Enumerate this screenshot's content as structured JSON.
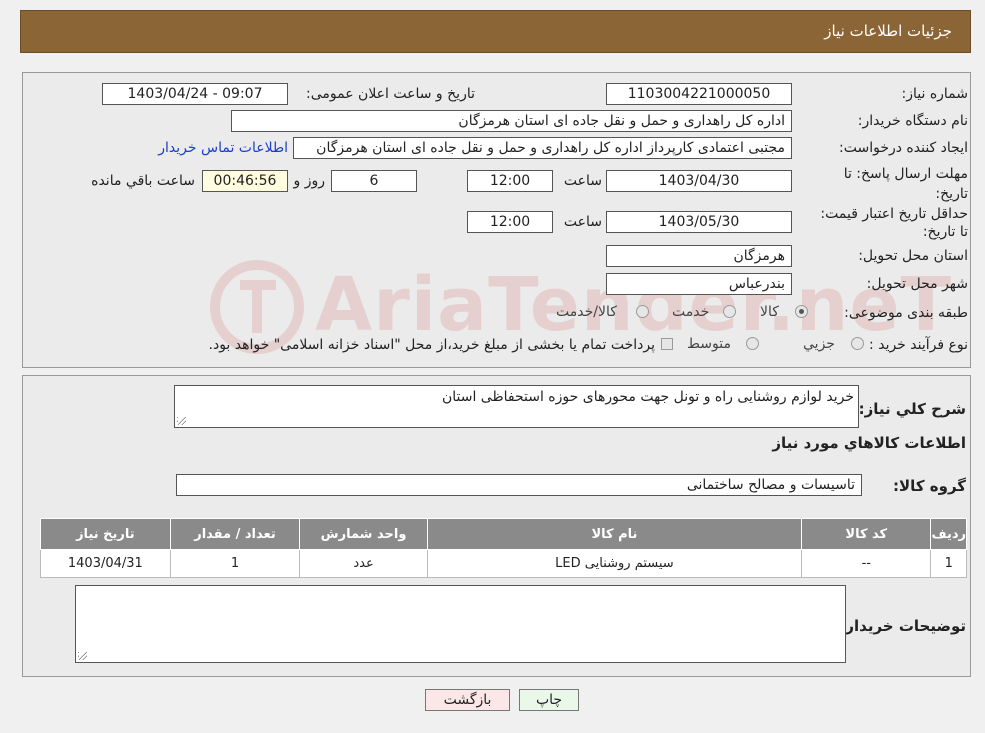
{
  "header": {
    "title": "جزئیات اطلاعات نیاز"
  },
  "form": {
    "need_number": {
      "label": "شماره نیاز:",
      "value": "1103004221000050"
    },
    "announce": {
      "label": "تاریخ و ساعت اعلان عمومی:",
      "value": "1403/04/24 - 09:07"
    },
    "buyer_org": {
      "label": "نام دستگاه خریدار:",
      "value": "اداره کل راهداری و حمل و نقل جاده ای استان هرمزگان"
    },
    "requester": {
      "label": "ایجاد کننده درخواست:",
      "value": "مجتبی اعتمادی کارپرداز اداره کل راهداری و حمل و نقل جاده ای استان هرمزگان",
      "contact_link": "اطلاعات تماس خریدار"
    },
    "deadline": {
      "label": "مهلت ارسال پاسخ: تا تاریخ:",
      "date": "1403/04/30",
      "time_label": "ساعت",
      "time": "12:00",
      "days": "6",
      "days_label": "روز و",
      "remaining": "00:46:56",
      "remaining_label": "ساعت باقي مانده"
    },
    "validity": {
      "label": "حداقل تاریخ اعتبار قیمت: تا تاریخ:",
      "date": "1403/05/30",
      "time_label": "ساعت",
      "time": "12:00"
    },
    "province": {
      "label": "استان محل تحویل:",
      "value": "هرمزگان"
    },
    "city": {
      "label": "شهر محل تحویل:",
      "value": "بندرعباس"
    },
    "category": {
      "label": "طبقه بندی موضوعی:",
      "options": [
        "کالا",
        "خدمت",
        "کالا/خدمت"
      ],
      "selected": "کالا"
    },
    "purchase_type": {
      "label": "نوع فرآیند خرید :",
      "options": [
        "جزیي",
        "متوسط"
      ],
      "note": "پرداخت تمام یا بخشی از مبلغ خرید،از محل \"اسناد خزانه اسلامی\" خواهد بود."
    }
  },
  "details": {
    "description_label": "شرح کلي نياز:",
    "description": "خرید لوازم روشنایی راه و تونل جهت محورهای حوزه استحفاظی استان",
    "goods_info_title": "اطلاعات کالاهاي مورد نياز",
    "goods_group_label": "گروه کالا:",
    "goods_group": "تاسیسات و مصالح ساختمانی",
    "table": {
      "headers": [
        "رديف",
        "کد کالا",
        "نام کالا",
        "واحد شمارش",
        "تعداد / مقدار",
        "تاريخ نياز"
      ],
      "rows": [
        [
          "1",
          "--",
          "سیستم روشنایی LED",
          "عدد",
          "1",
          "1403/04/31"
        ]
      ]
    },
    "buyer_notes_label": "توضيحات خريدار:",
    "buyer_notes": ""
  },
  "buttons": {
    "print": "چاپ",
    "back": "بازگشت"
  },
  "watermark": {
    "text": "AriaTender.neT",
    "color": "#cc2a2a"
  },
  "colors": {
    "header_bg": "#8b6535",
    "table_header_bg": "#8a8a8a",
    "link": "#1a3ecc"
  }
}
